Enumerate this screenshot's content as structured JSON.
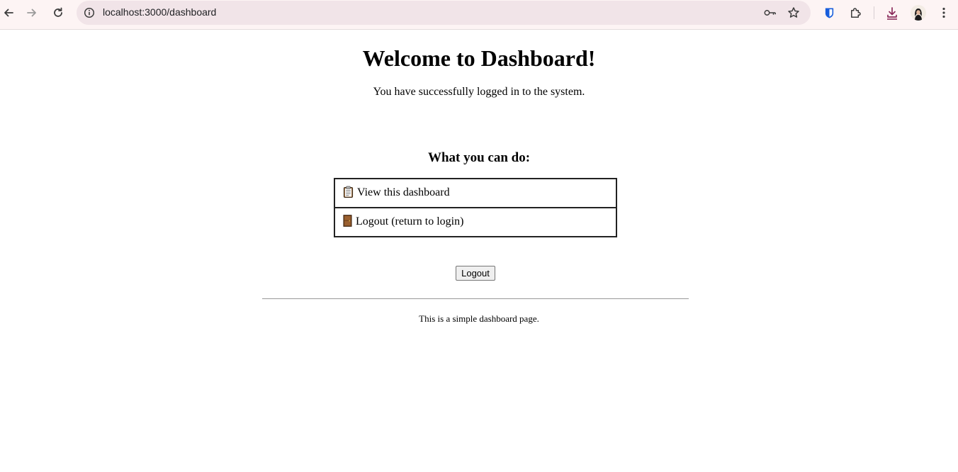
{
  "browser": {
    "url": "localhost:3000/dashboard"
  },
  "page": {
    "title": "Welcome to Dashboard!",
    "subtitle": "You have successfully logged in to the system.",
    "section_heading": "What you can do:",
    "actions": [
      {
        "icon": "clipboard-icon",
        "label": "View this dashboard"
      },
      {
        "icon": "door-icon",
        "label": "Logout (return to login)"
      }
    ],
    "logout_button_label": "Logout",
    "footer_text": "This is a simple dashboard page."
  }
}
